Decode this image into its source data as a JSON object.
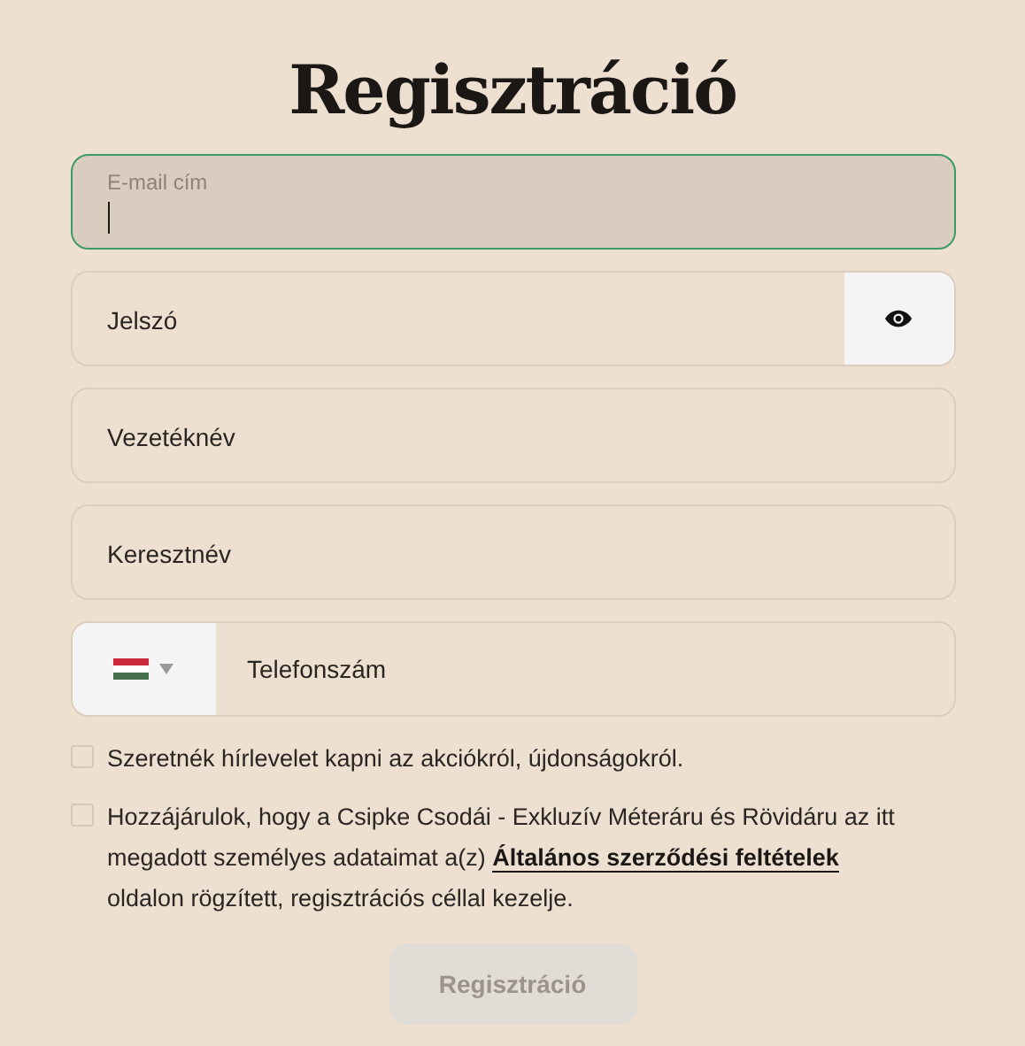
{
  "title": "Regisztráció",
  "fields": [
    {
      "kind": "text",
      "label": "E-mail cím",
      "focused": true
    },
    {
      "kind": "password",
      "label": "Jelszó",
      "focused": false
    },
    {
      "kind": "text",
      "label": "Vezetéknév",
      "focused": false
    },
    {
      "kind": "text",
      "label": "Keresztnév",
      "focused": false
    },
    {
      "kind": "phone",
      "label": "Telefonszám",
      "focused": false
    }
  ],
  "checkboxes": [
    {
      "checked": false,
      "text": "Szeretnék hírlevelet kapni az akciókról, újdonságokról."
    },
    {
      "checked": false,
      "text": "Hozzájárulok, hogy a Csipke Csodái - Exkluzív Méteráru és Rövidáru az itt megadott személyes adataimat a(z) ",
      "link": "Általános szerződési feltételek",
      "text_after": " oldalon rögzített, regisztrációs céllal kezelje."
    }
  ],
  "submit": {
    "label": "Regisztráció",
    "disabled": true
  }
}
